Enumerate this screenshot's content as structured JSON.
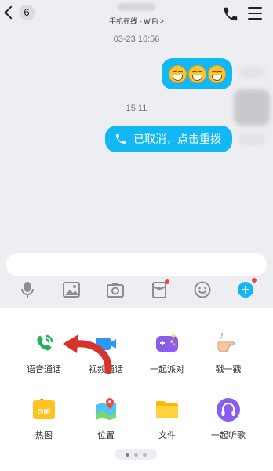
{
  "header": {
    "unread_count": "6",
    "status": "手机在线 - WiFi >"
  },
  "chat": {
    "timestamps": [
      "03-23 16:56",
      "15:11"
    ],
    "emoji_message": {
      "emoji_count": 3,
      "emoji": "grinning-face"
    },
    "call_message": {
      "text": "已取消，点击重拨"
    }
  },
  "toolbar": {
    "items": [
      "mic-icon",
      "image-icon",
      "camera-icon",
      "red-packet-icon",
      "emoji-icon",
      "plus-icon"
    ],
    "badges": [
      "red-packet-icon",
      "plus-icon"
    ]
  },
  "panel": {
    "items": [
      {
        "label": "语音通话",
        "icon": "voice-call-icon"
      },
      {
        "label": "视频通话",
        "icon": "video-call-icon"
      },
      {
        "label": "一起派对",
        "icon": "party-icon"
      },
      {
        "label": "戳一戳",
        "icon": "poke-icon"
      },
      {
        "label": "热图",
        "icon": "gif-icon"
      },
      {
        "label": "位置",
        "icon": "location-icon"
      },
      {
        "label": "文件",
        "icon": "folder-icon"
      },
      {
        "label": "一起听歌",
        "icon": "music-icon"
      }
    ],
    "pager": {
      "pages": 3,
      "active": 1
    }
  },
  "colors": {
    "accent": "#12b7f5",
    "background": "#edeef2",
    "badge": "#f0473a",
    "voice_call_green": "#1fb65d",
    "arrow_red": "#d6332a"
  }
}
